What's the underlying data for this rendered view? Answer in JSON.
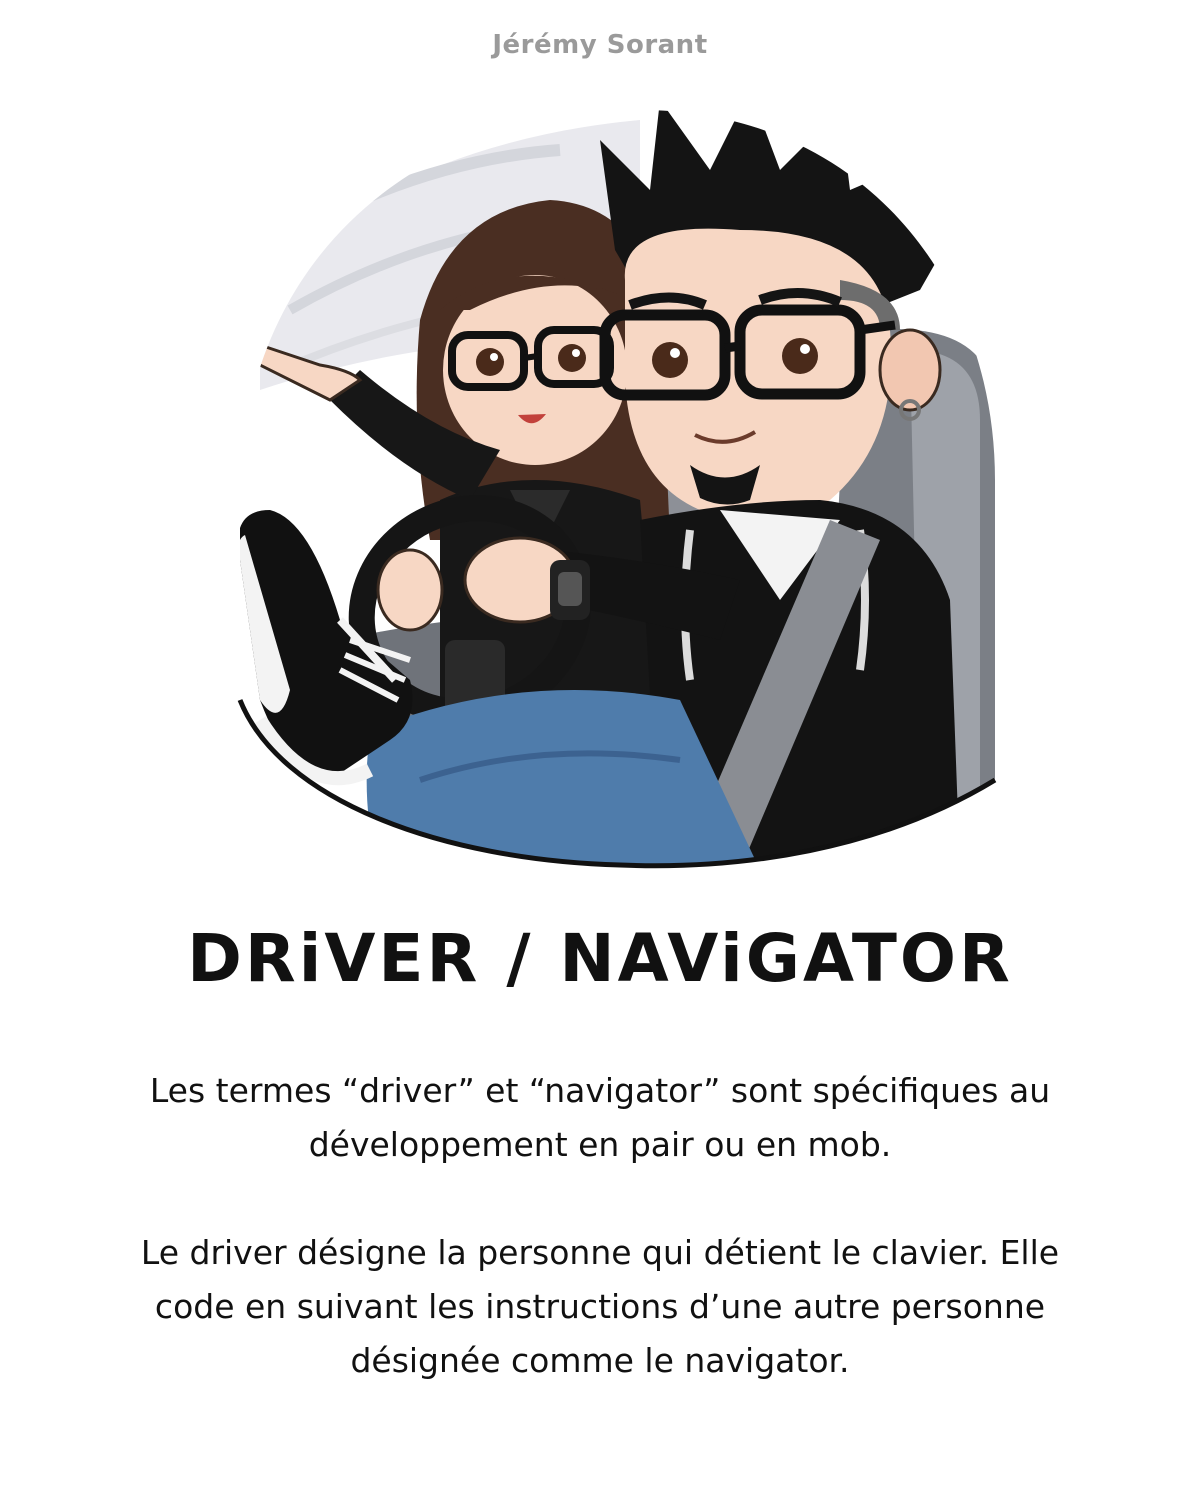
{
  "author": "Jérémy Sorant",
  "illustration": {
    "subject": "cartoon driver and navigator in a car"
  },
  "title": "DRiVER / NAViGATOR",
  "paragraphs": [
    "Les termes “driver” et “navigator” sont spécifiques au développement en pair ou en mob.",
    "Le driver désigne la personne qui détient le clavier. Elle code en suivant les instructions d’une autre personne désignée comme le navigator."
  ],
  "colors": {
    "text": "#111111",
    "author": "#9a9a9a",
    "background": "#ffffff"
  }
}
